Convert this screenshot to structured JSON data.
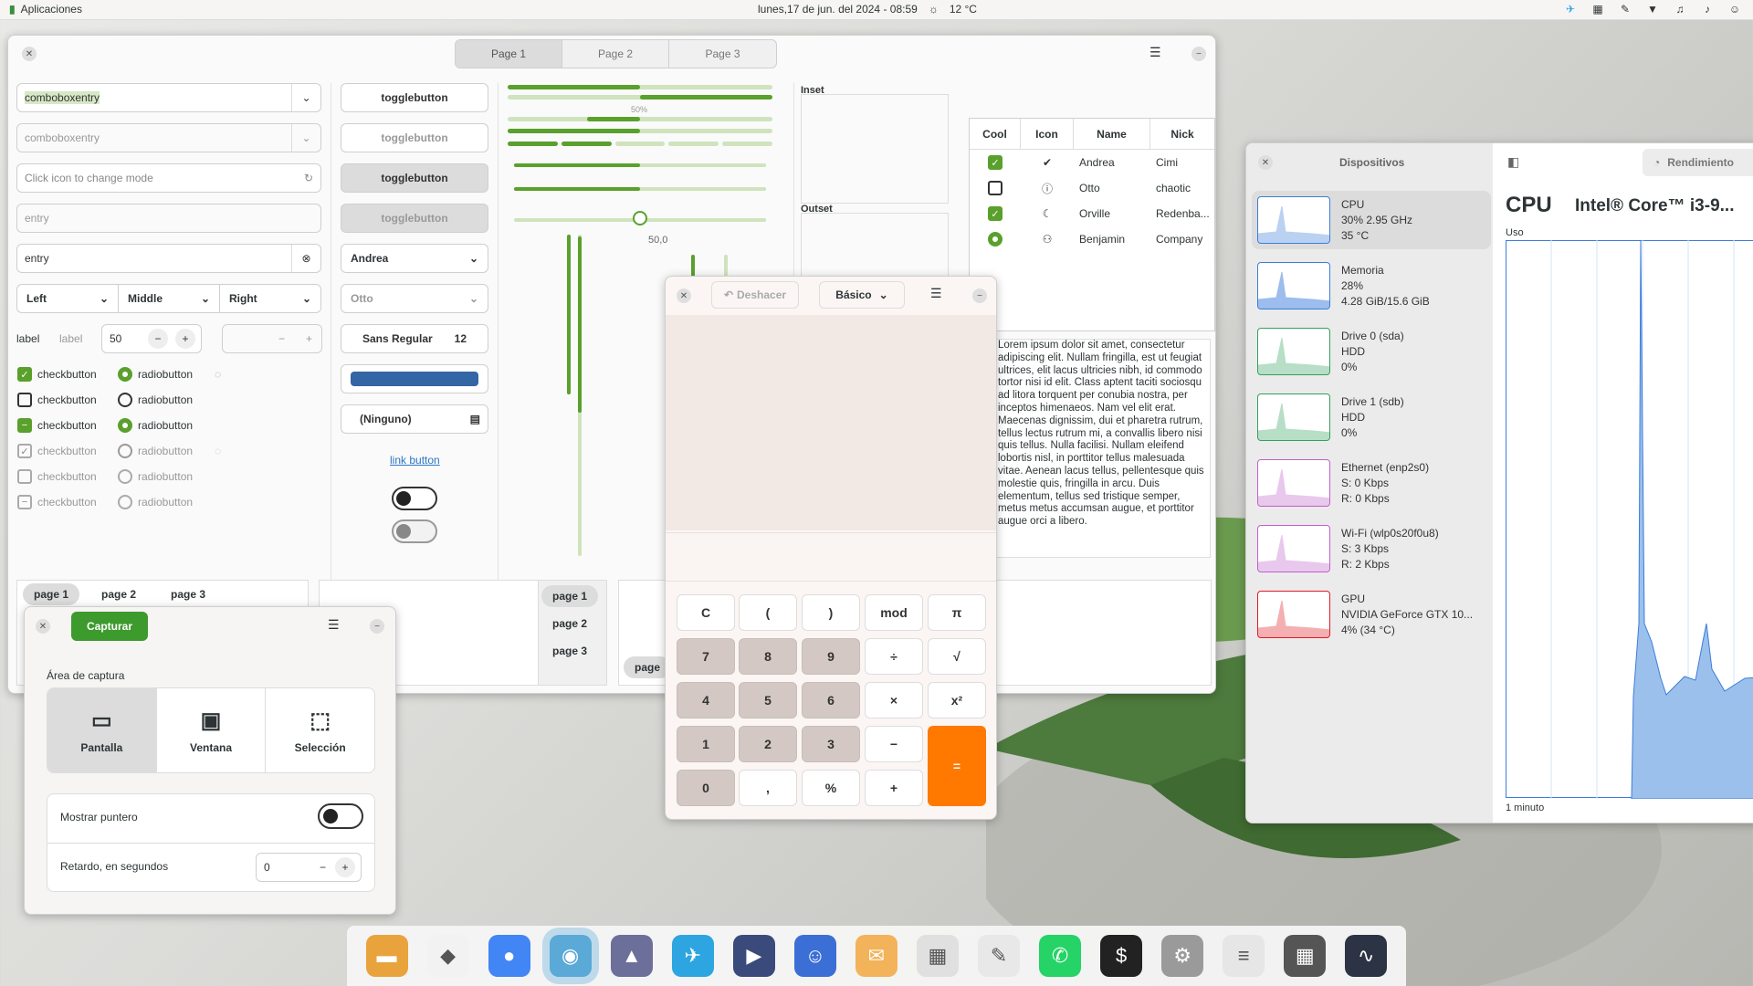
{
  "topbar": {
    "apps": "Aplicaciones",
    "datetime": "lunes,17 de jun. del 2024 - 08:59",
    "weather": "12 °C"
  },
  "widgets": {
    "tabs": [
      "Page 1",
      "Page 2",
      "Page 3"
    ],
    "combo1": "comboboxentry",
    "combo2": "comboboxentry",
    "mode_placeholder": "Click icon to change mode",
    "entry1": "entry",
    "entry2": "entry",
    "align": [
      "Left",
      "Middle",
      "Right"
    ],
    "label1": "label",
    "label2": "label",
    "spin_value": "50",
    "toggles": [
      "togglebutton",
      "togglebutton",
      "togglebutton",
      "togglebutton"
    ],
    "combo_andrea": "Andrea",
    "combo_otto": "Otto",
    "font": "Sans Regular",
    "font_size": "12",
    "file_none": "(Ninguno)",
    "link": "link button",
    "check_label": "checkbutton",
    "radio_label": "radiobutton",
    "progress_label": "50%",
    "scale_value": "50,0",
    "inset": "Inset",
    "outset": "Outset",
    "table_headers": [
      "Cool",
      "Icon",
      "Name",
      "Nick"
    ],
    "table_rows": [
      {
        "name": "Andrea",
        "nick": "Cimi",
        "icon": "check-circle-icon"
      },
      {
        "name": "Otto",
        "nick": "chaotic",
        "icon": "warning-icon"
      },
      {
        "name": "Orville",
        "nick": "Redenba...",
        "icon": "moon-icon"
      },
      {
        "name": "Benjamin",
        "nick": "Company",
        "icon": "robot-icon"
      }
    ],
    "lorem": "Lorem ipsum dolor sit amet, consectetur adipiscing elit. Nullam fringilla, est ut feugiat ultrices, elit lacus ultricies nibh, id commodo tortor nisi id elit. Class aptent taciti sociosqu ad litora torquent per conubia nostra, per inceptos himenaeos. Nam vel elit erat. Maecenas dignissim, dui et pharetra rutrum, tellus lectus rutrum mi, a convallis libero nisi quis tellus. Nulla facilisi. Nullam eleifend lobortis nisl, in porttitor tellus malesuada vitae. Aenean lacus tellus, pellentesque quis molestie quis, fringilla in arcu. Duis elementum, tellus sed tristique semper, metus metus accumsan augue, et porttitor augue orci a libero.",
    "page_tabs": [
      "page 1",
      "page 2",
      "page 3"
    ],
    "page_btn": "page"
  },
  "screenshot": {
    "capture": "Capturar",
    "area": "Área de captura",
    "modes": [
      "Pantalla",
      "Ventana",
      "Selección"
    ],
    "pointer": "Mostrar puntero",
    "delay": "Retardo, en segundos",
    "delay_value": "0"
  },
  "calculator": {
    "undo": "Deshacer",
    "mode": "Básico",
    "keys": [
      "C",
      "(",
      ")",
      "mod",
      "π",
      "7",
      "8",
      "9",
      "÷",
      "√",
      "4",
      "5",
      "6",
      "×",
      "x²",
      "1",
      "2",
      "3",
      "−",
      "=",
      "0",
      ",",
      "%",
      "+"
    ]
  },
  "monitor": {
    "title": "Dispositivos",
    "perf": "Rendimiento",
    "heading": "CPU",
    "cpu_name": "Intel® Core™ i3-9...",
    "usage": "Uso",
    "time": "1 minuto",
    "devices": [
      {
        "l1": "CPU",
        "l2": "30% 2.95 GHz",
        "l3": "35 °C",
        "color": "#3b7ddb"
      },
      {
        "l1": "Memoria",
        "l2": "28%",
        "l3": "4.28 GiB/15.6 GiB",
        "color": "#3b7ddb"
      },
      {
        "l1": "Drive 0 (sda)",
        "l2": "HDD",
        "l3": "0%",
        "color": "#33a05c"
      },
      {
        "l1": "Drive 1 (sdb)",
        "l2": "HDD",
        "l3": "0%",
        "color": "#33a05c"
      },
      {
        "l1": "Ethernet (enp2s0)",
        "l2": "S: 0 Kbps",
        "l3": "R: 0 Kbps",
        "color": "#c061cb"
      },
      {
        "l1": "Wi-Fi (wlp0s20f0u8)",
        "l2": "S: 3 Kbps",
        "l3": "R: 2 Kbps",
        "color": "#c061cb"
      },
      {
        "l1": "GPU",
        "l2": "NVIDIA GeForce GTX 10...",
        "l3": "4% (34 °C)",
        "color": "#e01b24"
      }
    ]
  },
  "dock": [
    "files-icon",
    "store-icon",
    "chrome-icon",
    "camera-icon",
    "image-viewer-icon",
    "telegram-icon",
    "video-icon",
    "contacts-icon",
    "mail-icon",
    "calendar-icon",
    "text-editor-icon",
    "whatsapp-icon",
    "terminal-icon",
    "settings-icon",
    "tweaks-icon",
    "calculator-icon",
    "system-monitor-icon"
  ]
}
